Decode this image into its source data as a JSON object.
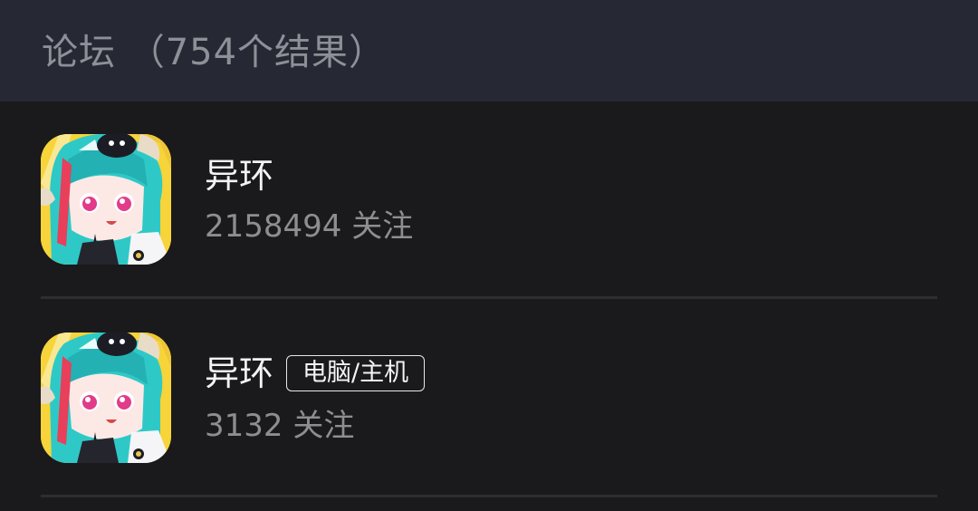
{
  "header": {
    "title": "论坛 （754个结果）"
  },
  "results": [
    {
      "name": "异环",
      "followers": "2158494 关注",
      "tag": ""
    },
    {
      "name": "异环",
      "followers": "3132 关注",
      "tag": "电脑/主机"
    }
  ],
  "colors": {
    "header_bg": "#262833",
    "list_bg": "#1a1a1c",
    "title_text": "#8e9097",
    "name_text": "#f3f3f5",
    "meta_text": "#8e8e92"
  },
  "icons": {
    "avatar": "game-avatar-icon"
  }
}
